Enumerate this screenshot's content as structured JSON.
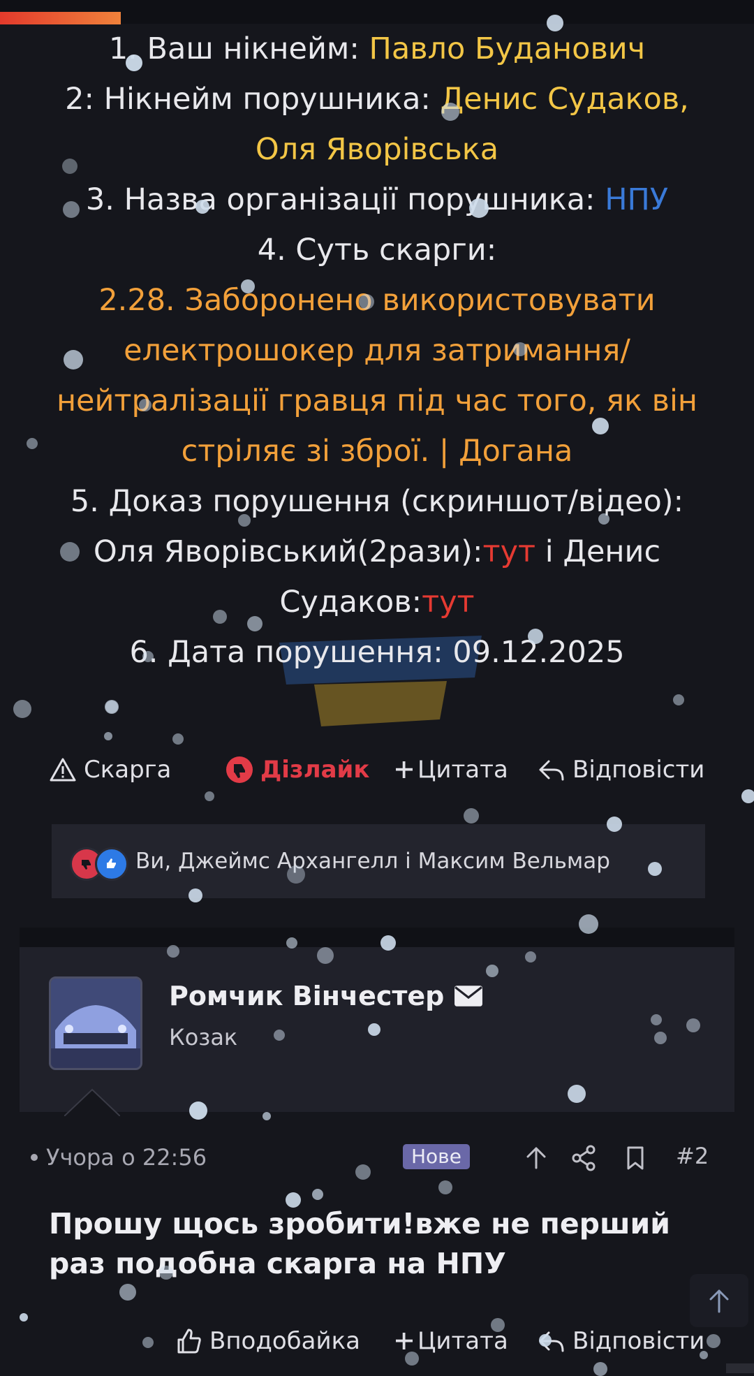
{
  "reading_progress": 0.16,
  "post": {
    "line1_label": "1. Ваш нікнейм: ",
    "line1_value": "Павло Буданович",
    "line2_label": "2: Нікнейм порушника: ",
    "line2_value_a": "Денис Судаков,",
    "line2_value_b": "Оля Яворівська",
    "line3_label": "3. Назва організації порушника: ",
    "line3_value": "НПУ",
    "line4_label": "4. Суть скарги:",
    "rule_line1": "2.28. Заборонено використовувати",
    "rule_line2": "електрошокер для затримання/",
    "rule_line3": "нейтралізації гравця під час того, як він",
    "rule_line4": "стріляє зі зброї. | Догана",
    "line5_label": "5. Доказ порушення (скриншот/відео):",
    "evidence_a": "Оля Яворівський(2рази):",
    "evidence_link1": "тут",
    "evidence_mid": " і Денис",
    "evidence_b": "Судаков:",
    "evidence_link2": "тут",
    "line6_label": "6. Дата порушення: ",
    "line6_value": "09.12.2025"
  },
  "actions": {
    "complaint": "Скарга",
    "dislike": "Дізлайк",
    "quote": "Цитата",
    "reply": "Відповісти"
  },
  "reactions": {
    "summary": "Ви, Джеймс Архангелл і Максим Вельмар"
  },
  "second_post": {
    "username": "Ромчик Вінчестер",
    "role": "Козак",
    "time": "Учора о 22:56",
    "badge": "Нове",
    "number": "#2",
    "text": "Прошу щось зробити!вже не перший раз подобна скарга на НПУ",
    "like": "Вподобайка",
    "quote": "Цитата",
    "reply": "Відповісти"
  },
  "colors": {
    "accent_yellow": "#f3c646",
    "accent_orange": "#f2a03a",
    "link_red": "#e53a32",
    "link_blue": "#3a7ad8",
    "dislike_red": "#e23b47",
    "badge_purple": "#6a68a8"
  }
}
